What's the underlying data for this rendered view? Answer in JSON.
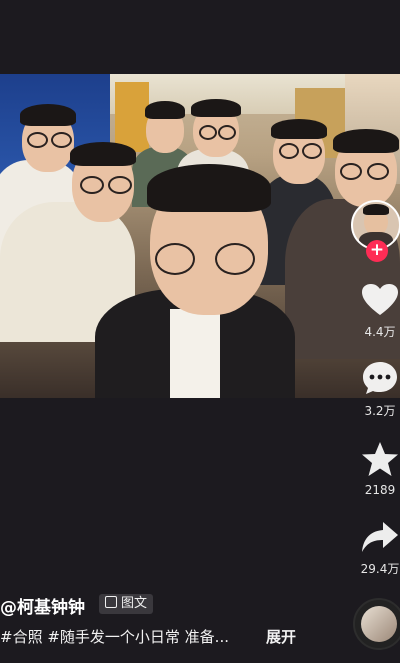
{
  "post": {
    "author": "@柯基钟钟",
    "type_badge": "图文",
    "caption": "#合照 #随手发一个小日常 准备...",
    "expand_label": "展开"
  },
  "actions": {
    "like_count": "4.4万",
    "comment_count": "3.2万",
    "favorite_count": "2189",
    "share_count": "29.4万",
    "follow_symbol": "+"
  },
  "icons": {
    "like": "heart-icon",
    "comment": "comment-bubble-icon",
    "favorite": "star-icon",
    "share": "share-arrow-icon",
    "music": "music-disc-icon"
  },
  "colors": {
    "background": "#1c1a1f",
    "follow_accent": "#fe2c55",
    "icon_white": "#ffffff"
  }
}
